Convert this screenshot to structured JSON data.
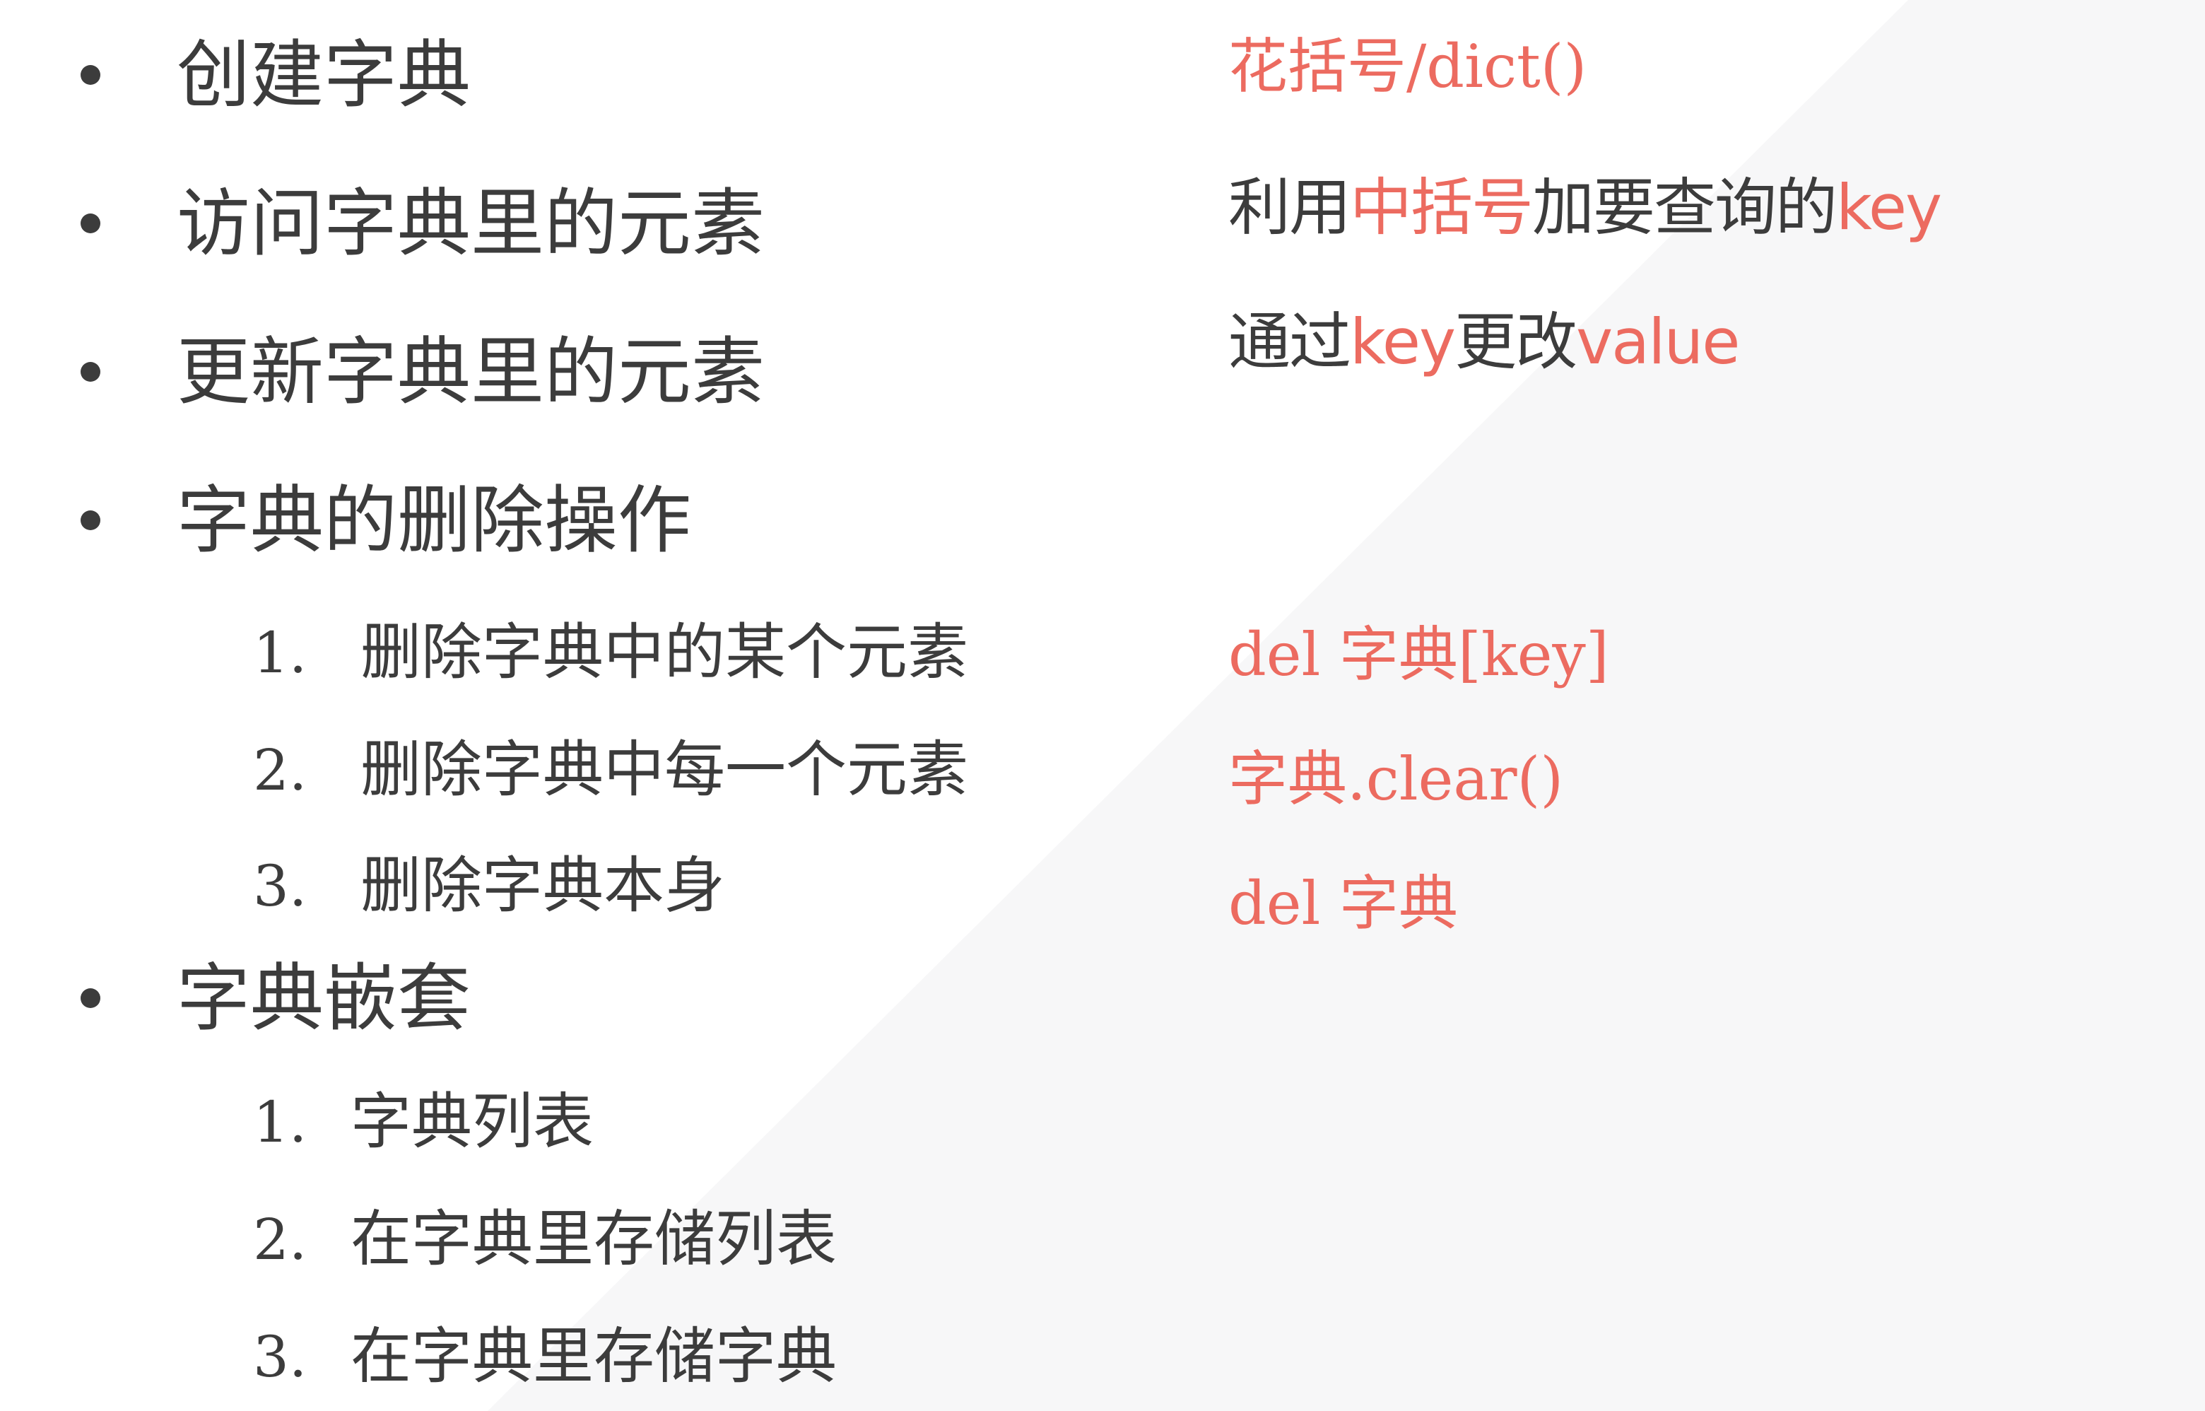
{
  "left": {
    "items": [
      {
        "title": "创建字典"
      },
      {
        "title": "访问字典里的元素"
      },
      {
        "title": "更新字典里的元素"
      },
      {
        "title": "字典的删除操作",
        "sub": [
          {
            "num": "1.",
            "text": "删除字典中的某个元素"
          },
          {
            "num": "2.",
            "text": "删除字典中每一个元素"
          },
          {
            "num": "3.",
            "text": "删除字典本身"
          }
        ]
      },
      {
        "title": "字典嵌套",
        "sub": [
          {
            "num": "1.",
            "text": "字典列表"
          },
          {
            "num": "2.",
            "text": "在字典里存储列表"
          },
          {
            "num": "3.",
            "text": "在字典里存储字典"
          }
        ]
      }
    ]
  },
  "right": {
    "create": "花括号/dict()",
    "access": {
      "p1": "利用",
      "p2": "中括号",
      "p3": "加要查询的",
      "p4": "key"
    },
    "update": {
      "p1": "通过",
      "p2": "key",
      "p3": "更改",
      "p4": "value"
    },
    "del_one": "del 字典[key]",
    "clear": "字典.clear()",
    "del_all": "del 字典"
  },
  "colors": {
    "text": "#3c3c3c",
    "accent": "#ec6b60",
    "background": "#ffffff",
    "shape": "#f7f7f8"
  }
}
